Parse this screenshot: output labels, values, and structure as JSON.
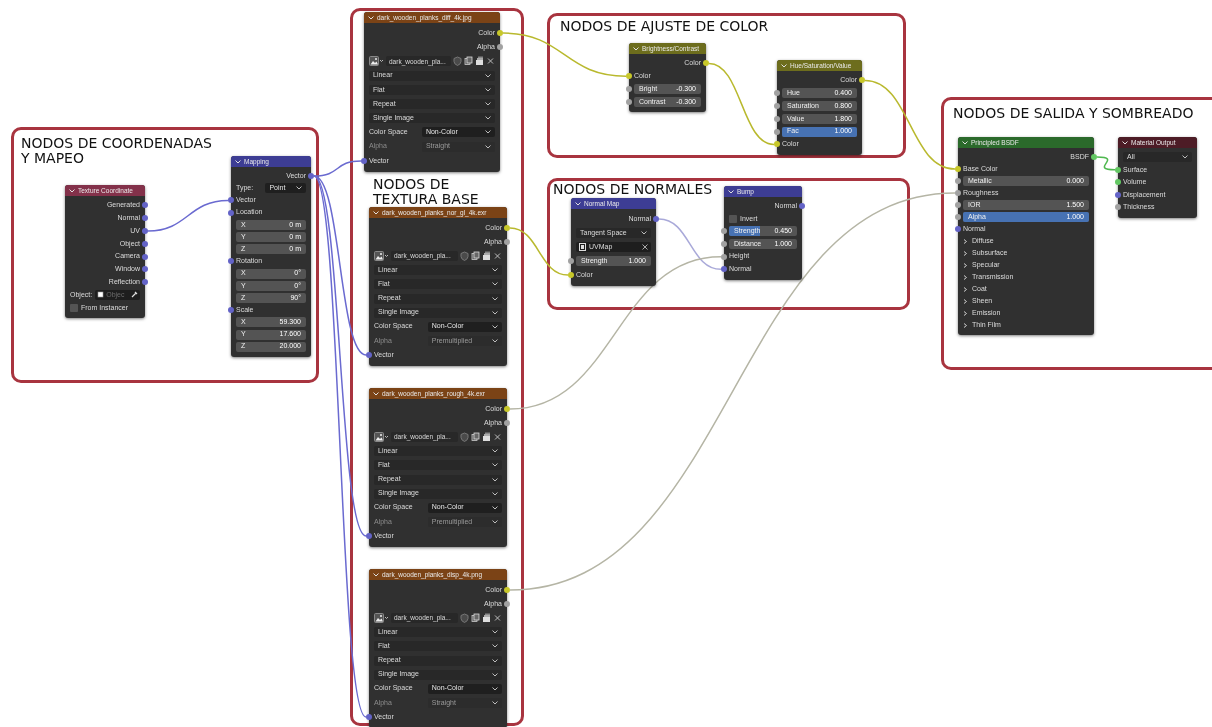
{
  "frames": [
    {
      "title_lines": [
        "NODOS DE COORDENADAS",
        "Y MAPEO"
      ]
    },
    {
      "title_lines": [
        "NODOS DE",
        "TEXTURA BASE"
      ]
    },
    {
      "title_lines": [
        "NODOS DE AJUSTE DE COLOR"
      ]
    },
    {
      "title_lines": [
        "NODOS DE NORMALES"
      ]
    },
    {
      "title_lines": [
        "NODOS DE SALIDA Y SOMBREADO"
      ]
    }
  ],
  "nodes": [
    {
      "kind": "input",
      "title": "Texture Coordinate",
      "rows": [
        {
          "kind": "output",
          "label": "Generated",
          "color": "#6363c7"
        },
        {
          "kind": "output",
          "label": "Normal",
          "color": "#6363c7"
        },
        {
          "kind": "output",
          "label": "UV",
          "color": "#6363c7"
        },
        {
          "kind": "output",
          "label": "Object",
          "color": "#6363c7"
        },
        {
          "kind": "output",
          "label": "Camera",
          "color": "#6363c7"
        },
        {
          "kind": "output",
          "label": "Window",
          "color": "#6363c7"
        },
        {
          "kind": "output",
          "label": "Reflection",
          "color": "#6363c7"
        },
        {
          "kind": "object",
          "label": "Object:",
          "placeholder": "Objec"
        },
        {
          "kind": "checkbox",
          "label": "From Instancer",
          "checked": false
        }
      ]
    },
    {
      "kind": "vector",
      "title": "Mapping",
      "rows": [
        {
          "kind": "output",
          "label": "Vector",
          "color": "#6363c7"
        },
        {
          "kind": "labeled_menu",
          "label": "Type:",
          "value": "Point",
          "disabled": false
        },
        {
          "kind": "input",
          "label": "Vector",
          "color": "#6363c7"
        },
        {
          "kind": "input",
          "label": "Location",
          "color": "#6363c7"
        },
        {
          "kind": "value",
          "label": "X",
          "value": "0 m"
        },
        {
          "kind": "value",
          "label": "Y",
          "value": "0 m"
        },
        {
          "kind": "value",
          "label": "Z",
          "value": "0 m"
        },
        {
          "kind": "input",
          "label": "Rotation",
          "color": "#6363c7"
        },
        {
          "kind": "value",
          "label": "X",
          "value": "0°"
        },
        {
          "kind": "value",
          "label": "Y",
          "value": "0°"
        },
        {
          "kind": "value",
          "label": "Z",
          "value": "90°"
        },
        {
          "kind": "input",
          "label": "Scale",
          "color": "#6363c7"
        },
        {
          "kind": "value",
          "label": "X",
          "value": "59.300"
        },
        {
          "kind": "value",
          "label": "Y",
          "value": "17.600"
        },
        {
          "kind": "value",
          "label": "Z",
          "value": "20.000"
        }
      ]
    },
    {
      "kind": "texture",
      "title": "dark_wooden_planks_diff_4k.jpg",
      "rows": [
        {
          "kind": "output",
          "label": "Color",
          "color": "#c7c729"
        },
        {
          "kind": "output",
          "label": "Alpha",
          "color": "#a1a1a1"
        },
        {
          "kind": "image",
          "value": "dark_wooden_pla..."
        },
        {
          "kind": "menu",
          "value": "Linear"
        },
        {
          "kind": "menu",
          "value": "Flat"
        },
        {
          "kind": "menu",
          "value": "Repeat"
        },
        {
          "kind": "menu",
          "value": "Single Image"
        },
        {
          "kind": "labeled_menu",
          "label": "Color Space",
          "value": "Non-Color",
          "disabled": false
        },
        {
          "kind": "labeled_menu",
          "label": "Alpha",
          "value": "Straight",
          "disabled": true
        },
        {
          "kind": "input",
          "label": "Vector",
          "color": "#6363c7"
        }
      ]
    },
    {
      "kind": "texture",
      "title": "dark_wooden_planks_nor_gl_4k.exr",
      "rows": [
        {
          "kind": "output",
          "label": "Color",
          "color": "#c7c729"
        },
        {
          "kind": "output",
          "label": "Alpha",
          "color": "#a1a1a1"
        },
        {
          "kind": "image",
          "value": "dark_wooden_pla..."
        },
        {
          "kind": "menu",
          "value": "Linear"
        },
        {
          "kind": "menu",
          "value": "Flat"
        },
        {
          "kind": "menu",
          "value": "Repeat"
        },
        {
          "kind": "menu",
          "value": "Single Image"
        },
        {
          "kind": "labeled_menu",
          "label": "Color Space",
          "value": "Non-Color",
          "disabled": false
        },
        {
          "kind": "labeled_menu",
          "label": "Alpha",
          "value": "Premultiplied",
          "disabled": true
        },
        {
          "kind": "input",
          "label": "Vector",
          "color": "#6363c7"
        }
      ]
    },
    {
      "kind": "texture",
      "title": "dark_wooden_planks_rough_4k.exr",
      "rows": [
        {
          "kind": "output",
          "label": "Color",
          "color": "#c7c729"
        },
        {
          "kind": "output",
          "label": "Alpha",
          "color": "#a1a1a1"
        },
        {
          "kind": "image",
          "value": "dark_wooden_pla..."
        },
        {
          "kind": "menu",
          "value": "Linear"
        },
        {
          "kind": "menu",
          "value": "Flat"
        },
        {
          "kind": "menu",
          "value": "Repeat"
        },
        {
          "kind": "menu",
          "value": "Single Image"
        },
        {
          "kind": "labeled_menu",
          "label": "Color Space",
          "value": "Non-Color",
          "disabled": false
        },
        {
          "kind": "labeled_menu",
          "label": "Alpha",
          "value": "Premultiplied",
          "disabled": true
        },
        {
          "kind": "input",
          "label": "Vector",
          "color": "#6363c7"
        }
      ]
    },
    {
      "kind": "texture",
      "title": "dark_wooden_planks_disp_4k.png",
      "rows": [
        {
          "kind": "output",
          "label": "Color",
          "color": "#c7c729"
        },
        {
          "kind": "output",
          "label": "Alpha",
          "color": "#a1a1a1"
        },
        {
          "kind": "image",
          "value": "dark_wooden_pla..."
        },
        {
          "kind": "menu",
          "value": "Linear"
        },
        {
          "kind": "menu",
          "value": "Flat"
        },
        {
          "kind": "menu",
          "value": "Repeat"
        },
        {
          "kind": "menu",
          "value": "Single Image"
        },
        {
          "kind": "labeled_menu",
          "label": "Color Space",
          "value": "Non-Color",
          "disabled": false
        },
        {
          "kind": "labeled_menu",
          "label": "Alpha",
          "value": "Straight",
          "disabled": true
        },
        {
          "kind": "input",
          "label": "Vector",
          "color": "#6363c7"
        }
      ]
    },
    {
      "kind": "color",
      "title": "Brightness/Contrast",
      "rows": [
        {
          "kind": "output",
          "label": "Color",
          "color": "#c7c729"
        },
        {
          "kind": "input",
          "label": "Color",
          "color": "#c7c729"
        },
        {
          "kind": "value",
          "label": "Bright",
          "value": "-0.300",
          "color": "#a1a1a1"
        },
        {
          "kind": "value",
          "label": "Contrast",
          "value": "-0.300",
          "color": "#a1a1a1"
        }
      ]
    },
    {
      "kind": "color",
      "title": "Hue/Saturation/Value",
      "rows": [
        {
          "kind": "output",
          "label": "Color",
          "color": "#c7c729"
        },
        {
          "kind": "value",
          "label": "Hue",
          "value": "0.400",
          "color": "#a1a1a1"
        },
        {
          "kind": "value",
          "label": "Saturation",
          "value": "0.800",
          "color": "#a1a1a1"
        },
        {
          "kind": "value",
          "label": "Value",
          "value": "1.800",
          "color": "#a1a1a1"
        },
        {
          "kind": "slider",
          "label": "Fac",
          "value": "1.000",
          "level": 1,
          "color": "#a1a1a1"
        },
        {
          "kind": "input",
          "label": "Color",
          "color": "#c7c729"
        }
      ]
    },
    {
      "kind": "vector",
      "title": "Normal Map",
      "rows": [
        {
          "kind": "output",
          "label": "Normal",
          "color": "#6363c7"
        },
        {
          "kind": "menu",
          "value": "Tangent Space"
        },
        {
          "kind": "uvmap",
          "value": "UVMap"
        },
        {
          "kind": "value",
          "label": "Strength",
          "value": "1.000",
          "color": "#a1a1a1"
        },
        {
          "kind": "input",
          "label": "Color",
          "color": "#c7c729"
        }
      ]
    },
    {
      "kind": "vector",
      "title": "Bump",
      "rows": [
        {
          "kind": "output",
          "label": "Normal",
          "color": "#6363c7"
        },
        {
          "kind": "checkbox",
          "label": "Invert",
          "checked": false
        },
        {
          "kind": "slider",
          "label": "Strength",
          "value": "0.450",
          "level": 0.45,
          "color": "#a1a1a1"
        },
        {
          "kind": "value",
          "label": "Distance",
          "value": "1.000",
          "color": "#a1a1a1"
        },
        {
          "kind": "input",
          "label": "Height",
          "color": "#a1a1a1"
        },
        {
          "kind": "input",
          "label": "Normal",
          "color": "#6363c7"
        }
      ]
    },
    {
      "kind": "shader",
      "title": "Principled BSDF",
      "rows": [
        {
          "kind": "output",
          "label": "BSDF",
          "color": "#63c763"
        },
        {
          "kind": "input",
          "label": "Base Color",
          "color": "#c7c729"
        },
        {
          "kind": "value",
          "label": "Metallic",
          "value": "0.000",
          "color": "#a1a1a1"
        },
        {
          "kind": "input",
          "label": "Roughness",
          "color": "#a1a1a1"
        },
        {
          "kind": "value",
          "label": "IOR",
          "value": "1.500",
          "color": "#a1a1a1"
        },
        {
          "kind": "slider",
          "label": "Alpha",
          "value": "1.000",
          "level": 1,
          "color": "#a1a1a1"
        },
        {
          "kind": "input",
          "label": "Normal",
          "color": "#6363c7"
        },
        {
          "kind": "panel",
          "label": "Diffuse",
          "expanded": false
        },
        {
          "kind": "panel",
          "label": "Subsurface",
          "expanded": false
        },
        {
          "kind": "panel",
          "label": "Specular",
          "expanded": false
        },
        {
          "kind": "panel",
          "label": "Transmission",
          "expanded": false
        },
        {
          "kind": "panel",
          "label": "Coat",
          "expanded": false
        },
        {
          "kind": "panel",
          "label": "Sheen",
          "expanded": false
        },
        {
          "kind": "panel",
          "label": "Emission",
          "expanded": false
        },
        {
          "kind": "panel",
          "label": "Thin Film",
          "expanded": false
        }
      ]
    },
    {
      "kind": "output",
      "title": "Material Output",
      "rows": [
        {
          "kind": "menu",
          "value": "All"
        },
        {
          "kind": "input",
          "label": "Surface",
          "color": "#63c763"
        },
        {
          "kind": "input",
          "label": "Volume",
          "color": "#63c763"
        },
        {
          "kind": "input",
          "label": "Displacement",
          "color": "#6363c7"
        },
        {
          "kind": "input",
          "label": "Thickness",
          "color": "#a1a1a1"
        }
      ]
    }
  ]
}
